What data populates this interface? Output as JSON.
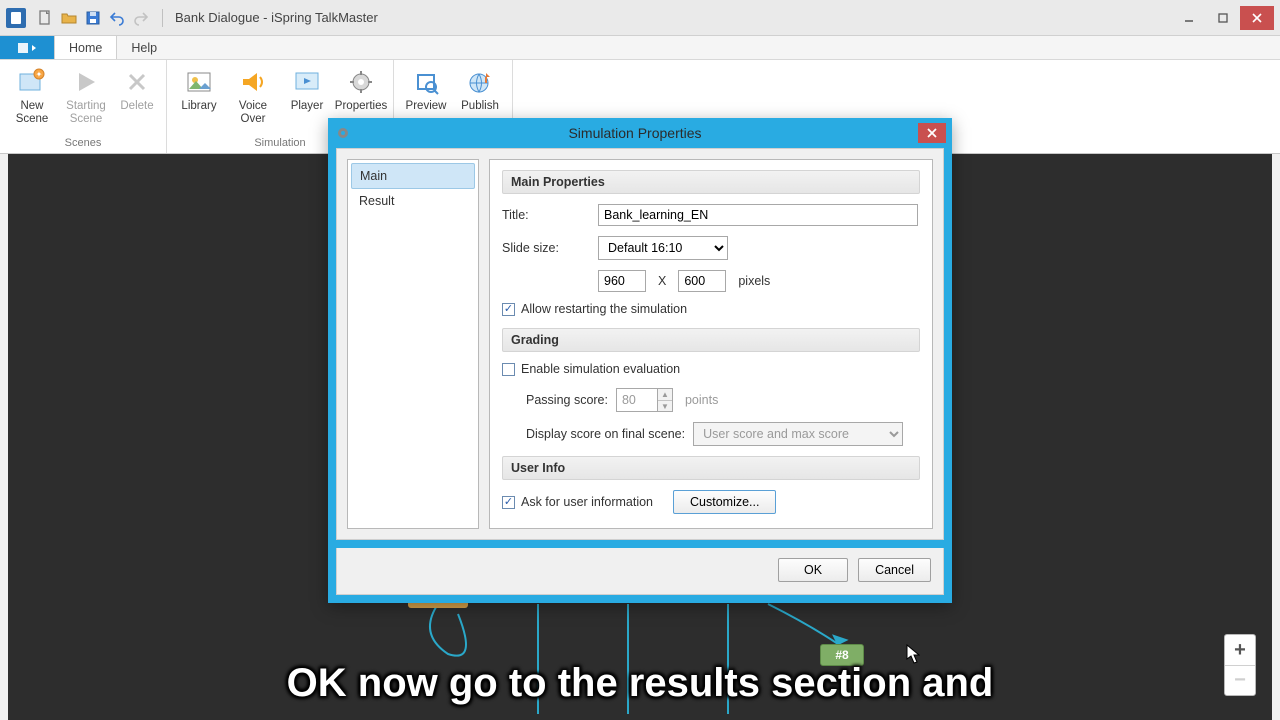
{
  "window": {
    "title": "Bank Dialogue - iSpring TalkMaster"
  },
  "menubar": {
    "home": "Home",
    "help": "Help"
  },
  "ribbon": {
    "new_scene": "New\nScene",
    "starting_scene": "Starting\nScene",
    "delete": "Delete",
    "library": "Library",
    "voice_over": "Voice\nOver",
    "player": "Player",
    "properties": "Properties",
    "preview": "Preview",
    "publish": "Publish",
    "group_scenes": "Scenes",
    "group_simulation": "Simulation"
  },
  "dialog": {
    "title": "Simulation Properties",
    "nav": {
      "main": "Main",
      "result": "Result"
    },
    "section_main": "Main Properties",
    "title_label": "Title:",
    "title_value": "Bank_learning_EN",
    "slide_size_label": "Slide size:",
    "slide_size_value": "Default 16:10",
    "width": "960",
    "x": "X",
    "height": "600",
    "pixels": "pixels",
    "allow_restart": "Allow restarting the simulation",
    "section_grading": "Grading",
    "enable_eval": "Enable simulation evaluation",
    "passing_label": "Passing score:",
    "passing_value": "80",
    "points": "points",
    "display_label": "Display score on final scene:",
    "display_value": "User score and max score",
    "section_userinfo": "User Info",
    "ask_user": "Ask for user information",
    "customize": "Customize...",
    "ok": "OK",
    "cancel": "Cancel"
  },
  "canvas": {
    "node_8": "#8"
  },
  "caption": "OK now go to the results section and"
}
